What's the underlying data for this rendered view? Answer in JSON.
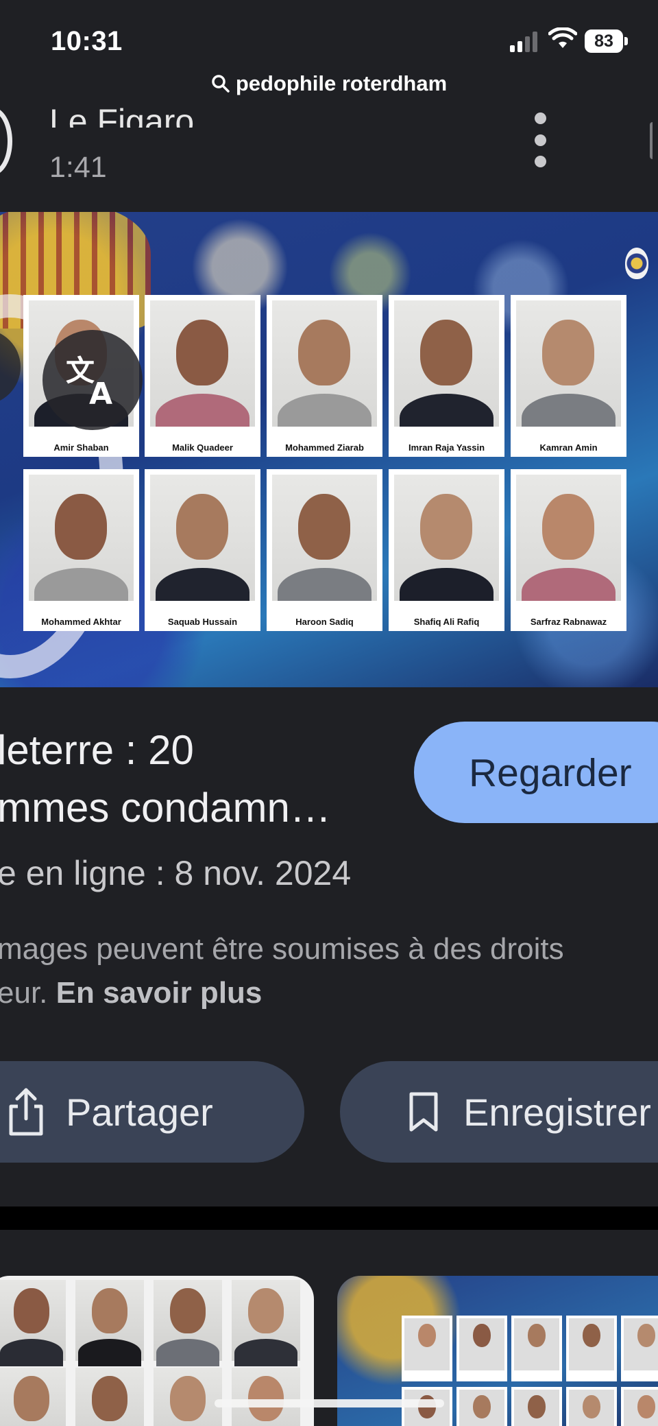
{
  "status_bar": {
    "time": "10:31",
    "battery": "83"
  },
  "search": {
    "query": "pedophile roterdham"
  },
  "source": {
    "name": "Le Figaro",
    "duration": "1:41"
  },
  "image": {
    "row1": [
      "Amir Shaban",
      "Malik Quadeer",
      "Mohammed Ziarab",
      "Imran Raja Yassin",
      "Kamran Amin"
    ],
    "row2": [
      "Mohammed Akhtar",
      "Saquab Hussain",
      "Haroon Sadiq",
      "Shafiq Ali Rafiq",
      "Sarfraz Rabnawaz"
    ]
  },
  "result": {
    "title": "leterre : 20\nmmes condamn…",
    "watch_label": "Regarder",
    "date_line": "e en ligne : 8 nov. 2024",
    "rights_text": "mages peuvent être soumises à des droits\neur. ",
    "learn_more": "En savoir plus"
  },
  "actions": {
    "share_label": "Partager",
    "save_label": "Enregistrer"
  },
  "colors": {
    "background": "#1f2024",
    "watch_button": "#8ab4f8",
    "action_button": "#3a4356"
  },
  "icons": [
    "search-icon",
    "signal-icon",
    "wifi-icon",
    "battery-icon",
    "more-vert-icon",
    "translate-icon",
    "share-icon",
    "bookmark-icon"
  ]
}
